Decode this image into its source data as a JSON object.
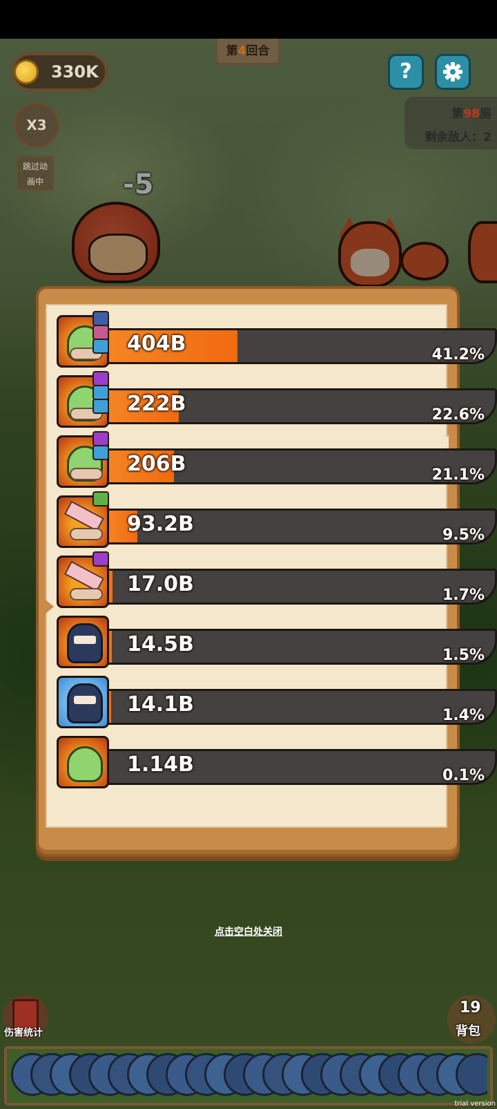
{
  "hud": {
    "coins": "330K",
    "round_prefix": "第",
    "round_num": "4",
    "round_suffix": "回合",
    "speed": "X3",
    "skip_label_1": "跳过动",
    "skip_label_2": "画中",
    "help_glyph": "?",
    "floor_prefix": "第",
    "floor_num": "98",
    "floor_suffix": "层",
    "enemies_left": "剩余敌人：2"
  },
  "battle": {
    "damage_popup": "-5"
  },
  "damage_stats": {
    "rows": [
      {
        "value": "404B",
        "percent": "41.2%",
        "fraction": 0.412,
        "icon": "slime-scroll-icon",
        "frame": "orange",
        "minis": [
          "#3c5fa8",
          "#c65b8f",
          "#3fa0d8"
        ]
      },
      {
        "value": "222B",
        "percent": "22.6%",
        "fraction": 0.226,
        "icon": "slime-scroll-icon",
        "frame": "orange",
        "minis": [
          "#9b3fc9",
          "#3fa0d8",
          "#3fa0d8"
        ]
      },
      {
        "value": "206B",
        "percent": "21.1%",
        "fraction": 0.211,
        "icon": "slime-scroll-icon",
        "frame": "orange",
        "minis": [
          "#9b3fc9",
          "#3fa0d8"
        ]
      },
      {
        "value": "93.2B",
        "percent": "9.5%",
        "fraction": 0.095,
        "icon": "blade-scroll-icon",
        "frame": "orange",
        "minis": [
          "#5fb24a"
        ]
      },
      {
        "value": "17.0B",
        "percent": "1.7%",
        "fraction": 0.017,
        "icon": "blade-scroll-icon",
        "frame": "orange",
        "minis": [
          "#9b3fc9"
        ]
      },
      {
        "value": "14.5B",
        "percent": "1.5%",
        "fraction": 0.015,
        "icon": "ninja-icon",
        "frame": "orange",
        "minis": []
      },
      {
        "value": "14.1B",
        "percent": "1.4%",
        "fraction": 0.014,
        "icon": "ninja-icon",
        "frame": "blue",
        "minis": []
      },
      {
        "value": "1.14B",
        "percent": "0.1%",
        "fraction": 0.001,
        "icon": "slime-icon",
        "frame": "orange",
        "minis": []
      }
    ],
    "close_hint": "点击空白处关闭"
  },
  "bottom": {
    "stats_label": "伤害统计",
    "bag_count": "19",
    "bag_label": "背包",
    "watermark": "trial version"
  },
  "colors": {
    "bar_fill": "#f06a10",
    "bar_track": "#454140",
    "panel": "#c98b48",
    "panel_inner": "#f5e7cb"
  }
}
